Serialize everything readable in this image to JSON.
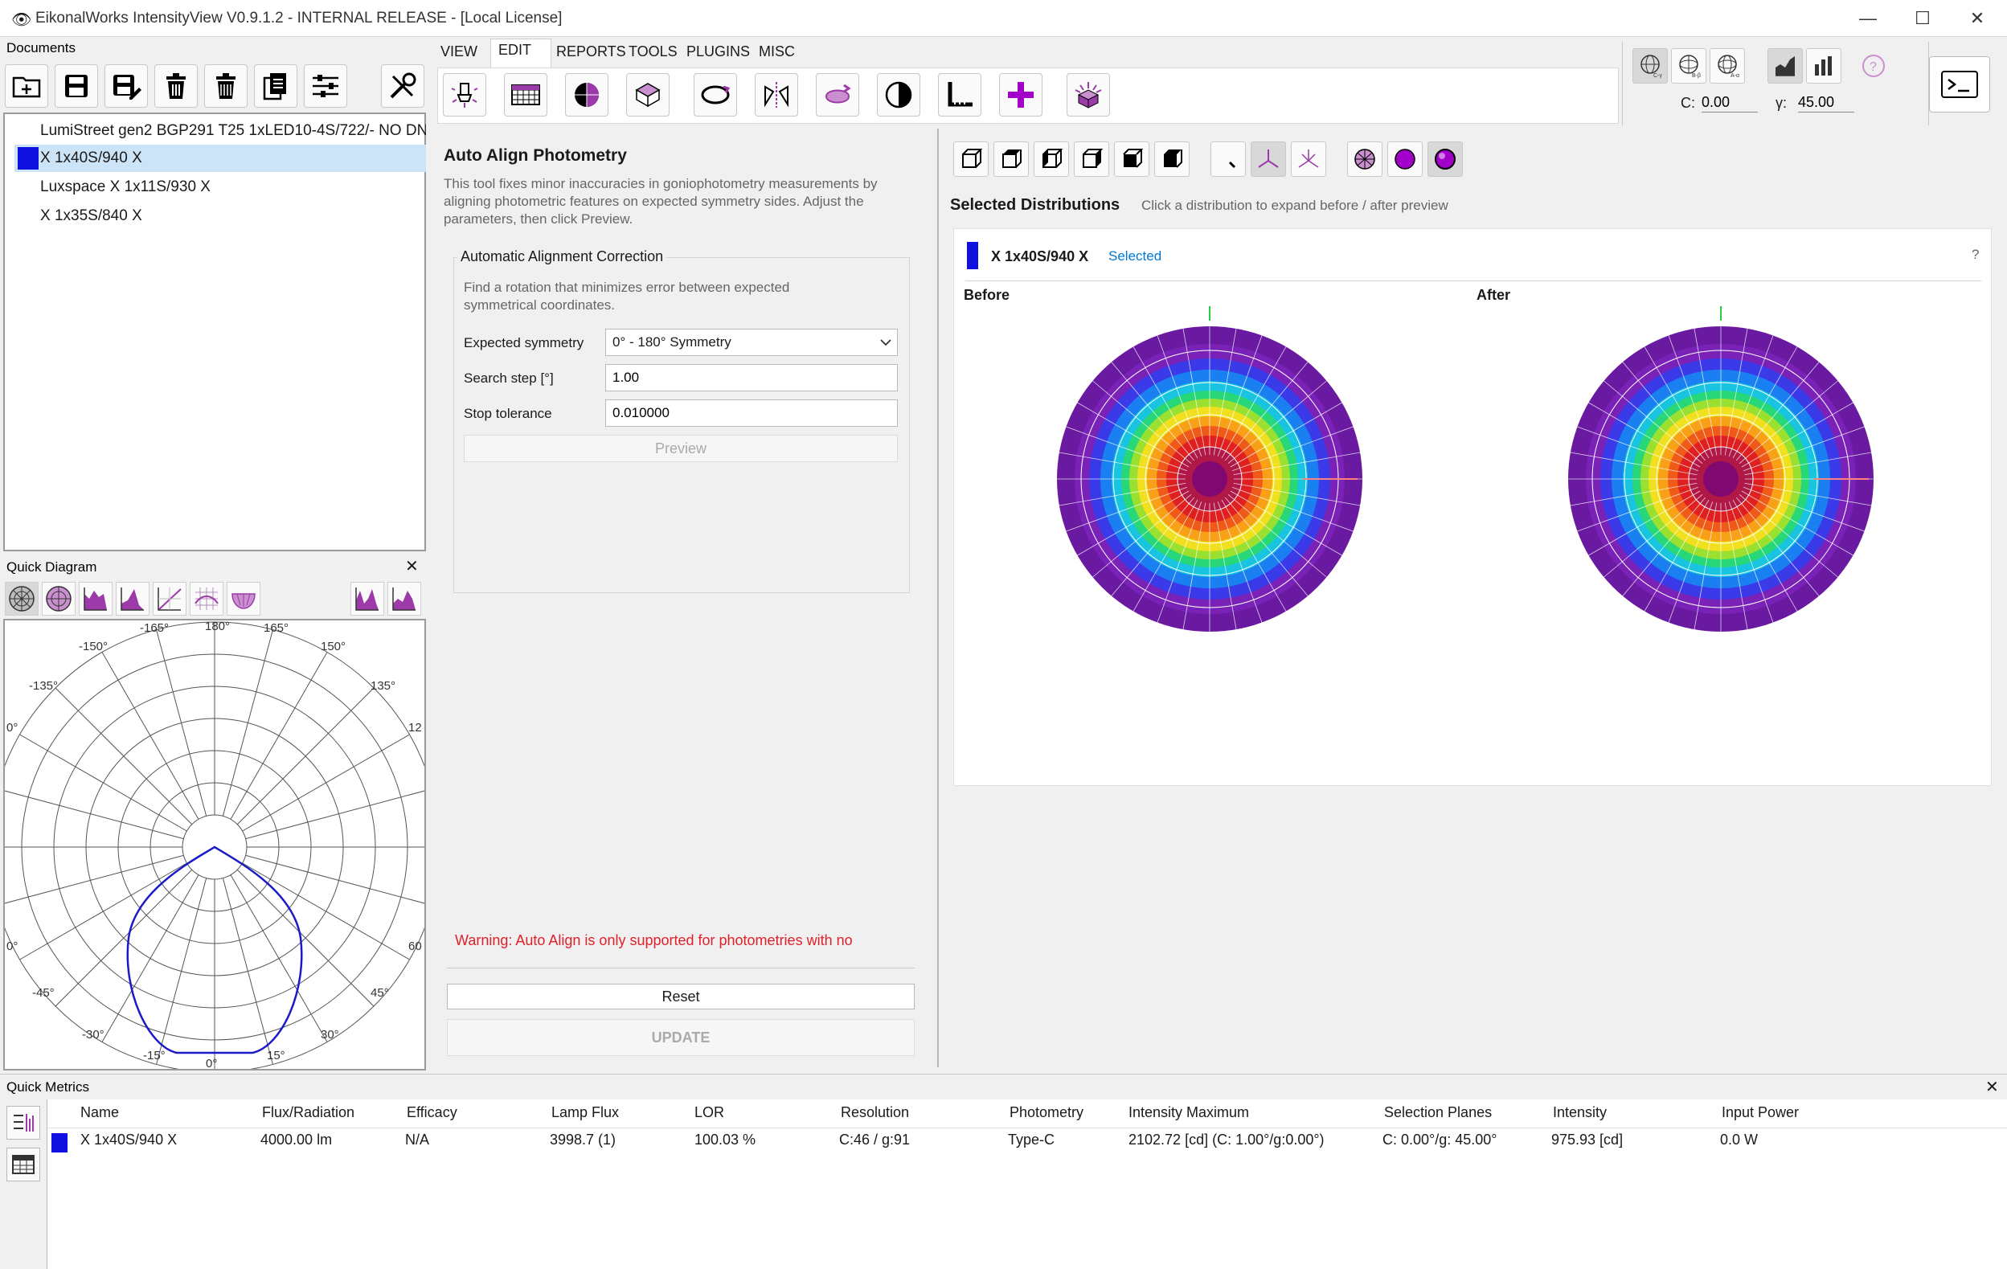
{
  "window": {
    "title": "EikonalWorks IntensityView V0.9.1.2 - INTERNAL RELEASE - [Local License]",
    "controls": [
      "—",
      "☐",
      "✕"
    ]
  },
  "documents": {
    "title": "Documents",
    "items": [
      {
        "label": "LumiStreet gen2 BGP291 T25 1xLED10-4S/722/- NO DN",
        "color": ""
      },
      {
        "label": "X 1x40S/940 X",
        "color": "#1010e0",
        "selected": true
      },
      {
        "label": "Luxspace X 1x11S/930 X",
        "color": ""
      },
      {
        "label": "X 1x35S/840 X",
        "color": ""
      }
    ]
  },
  "menu": {
    "tabs": [
      "VIEW",
      "EDIT",
      "REPORTS",
      "TOOLS",
      "PLUGINS",
      "MISC"
    ],
    "active": "EDIT"
  },
  "coords": {
    "c_label": "C:",
    "c_value": "0.00",
    "g_label": "γ:",
    "g_value": "45.00"
  },
  "auto_align": {
    "title": "Auto Align Photometry",
    "description": "This tool fixes minor inaccuracies in goniophotometry measurements by aligning photometric features on expected symmetry sides. Adjust the parameters, then click Preview.",
    "group_title": "Automatic Alignment Correction",
    "group_desc": "Find a rotation that minimizes error between expected symmetrical coordinates.",
    "symmetry_label": "Expected symmetry",
    "symmetry_value": "0° - 180° Symmetry",
    "step_label": "Search step [°]",
    "step_value": "1.00",
    "tol_label": "Stop tolerance",
    "tol_value": "0.010000",
    "preview_label": "Preview",
    "warning": "Warning: Auto Align is only supported for photometries with no",
    "reset_label": "Reset",
    "update_label": "UPDATE"
  },
  "selected_dist": {
    "title": "Selected Distributions",
    "hint": "Click a distribution to expand before / after preview",
    "item_name": "X 1x40S/940 X",
    "item_status": "Selected",
    "help": "?",
    "before_label": "Before",
    "after_label": "After"
  },
  "quick_diagram": {
    "title": "Quick Diagram",
    "close": "✕",
    "angle_labels": [
      "-165°",
      "180°",
      "165°",
      "-150°",
      "150°",
      "-135°",
      "135°",
      "0°",
      "12",
      "0°",
      "60",
      "-45°",
      "45°",
      "-30°",
      "30°",
      "-15°",
      "0°",
      "15°"
    ]
  },
  "quick_metrics": {
    "title": "Quick Metrics",
    "close": "✕",
    "columns": [
      "Name",
      "Flux/Radiation",
      "Efficacy",
      "Lamp Flux",
      "LOR",
      "Resolution",
      "Photometry",
      "Intensity Maximum",
      "Selection Planes",
      "Intensity",
      "Input Power"
    ],
    "rows": [
      {
        "color": "#1010e0",
        "cells": [
          "X 1x40S/940 X",
          "4000.00 lm",
          "N/A",
          "3998.7 (1)",
          "100.03 %",
          "C:46 / g:91",
          "Type-C",
          "2102.72 [cd] (C: 1.00°/g:0.00°)",
          "C: 0.00°/g: 45.00°",
          "975.93 [cd]",
          "0.0 W"
        ]
      }
    ]
  },
  "colors": {
    "accent": "#0078d4",
    "warning": "#e0202a",
    "selection": "#cce4f7",
    "series_blue": "#1010e0"
  }
}
